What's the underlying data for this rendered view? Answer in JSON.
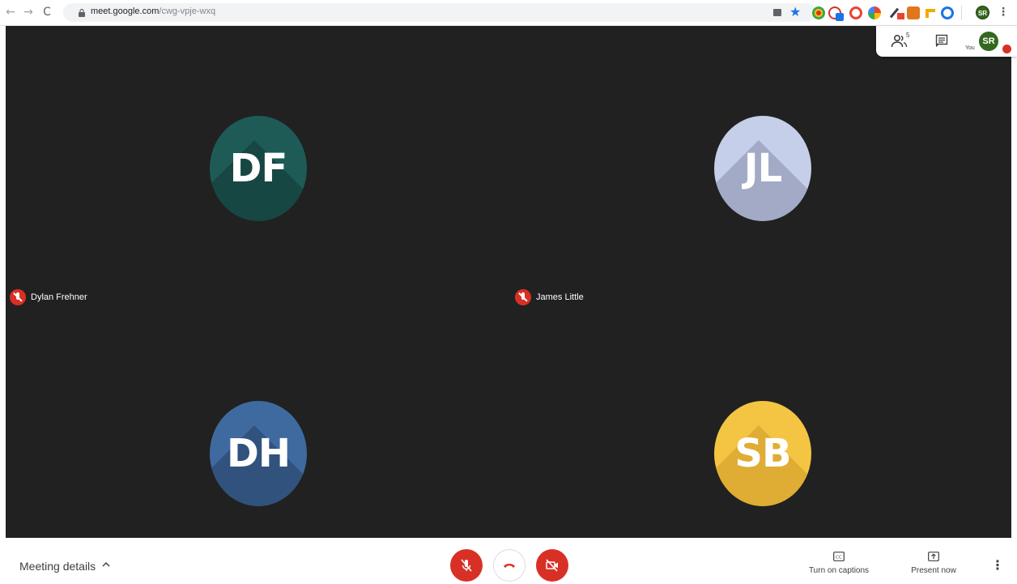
{
  "browser": {
    "url_domain": "meet.google.com",
    "url_path": "/cwg-vpje-wxq",
    "nav_back": "←",
    "nav_forward": "→",
    "nav_reload": "C",
    "profile_initials": "SR",
    "menu_glyph": "⋮",
    "star_glyph": "★"
  },
  "participants": [
    {
      "name": "Dylan Frehner",
      "initials": "DF",
      "color": "#1e5b57",
      "muted": true
    },
    {
      "name": "James Little",
      "initials": "JL",
      "color": "#c5cfe9",
      "muted": true
    },
    {
      "name": "",
      "initials": "DH",
      "color": "#3f6aa0",
      "muted": false
    },
    {
      "name": "",
      "initials": "SB",
      "color": "#f4c542",
      "muted": false
    }
  ],
  "top_panel": {
    "people_count": "5",
    "self_initials": "SR",
    "self_label": "You"
  },
  "controls": {
    "meeting_details_label": "Meeting details",
    "captions_label": "Turn on captions",
    "present_label": "Present now",
    "more_glyph": "⋮"
  },
  "colors": {
    "stage_bg": "#212121",
    "muted_red": "#d93025",
    "self_avatar": "#33691e"
  }
}
